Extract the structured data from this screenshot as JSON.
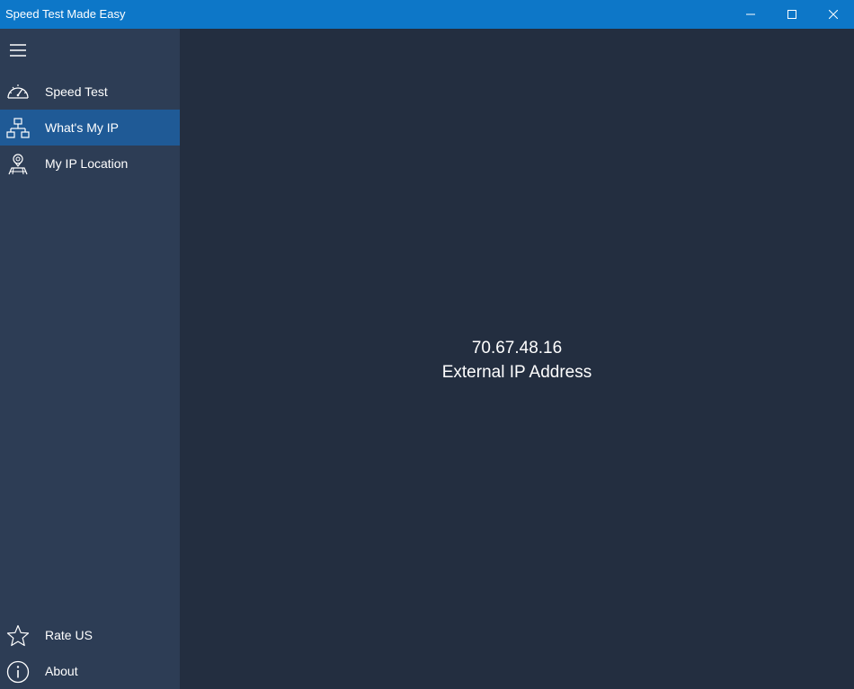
{
  "window": {
    "title": "Speed Test Made Easy"
  },
  "sidebar": {
    "menu_icon": "hamburger-icon",
    "items": [
      {
        "label": "Speed Test",
        "icon": "speedometer-icon",
        "selected": false
      },
      {
        "label": "What's My IP",
        "icon": "network-icon",
        "selected": true
      },
      {
        "label": "My IP Location",
        "icon": "location-person-icon",
        "selected": false
      }
    ],
    "footer_items": [
      {
        "label": "Rate US",
        "icon": "star-icon"
      },
      {
        "label": "About",
        "icon": "info-icon"
      }
    ]
  },
  "main": {
    "ip_address": "70.67.48.16",
    "ip_label": "External IP Address"
  },
  "colors": {
    "titlebar": "#0d77c8",
    "sidebar": "#2d3d55",
    "selected_item": "#1f5a96",
    "content_bg": "#232e40",
    "text": "#ffffff"
  }
}
